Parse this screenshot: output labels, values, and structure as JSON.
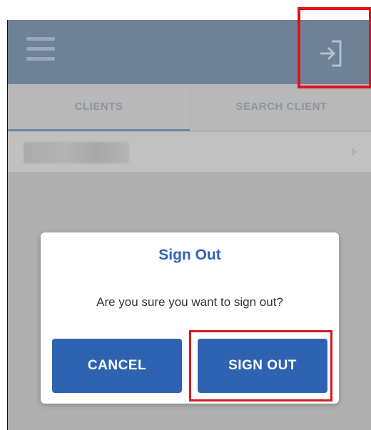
{
  "header": {
    "menu_icon": "hamburger-menu-icon",
    "signout_icon": "sign-out-icon"
  },
  "tabs": [
    {
      "label": "CLIENTS"
    },
    {
      "label": "SEARCH CLIENT"
    }
  ],
  "list": {
    "chevron": "›"
  },
  "dialog": {
    "title": "Sign Out",
    "message": "Are you sure you want to sign out?",
    "cancel_label": "CANCEL",
    "confirm_label": "SIGN OUT"
  },
  "colors": {
    "header_bg": "#6e8197",
    "dialog_title": "#2f63b4",
    "button_bg": "#2e63b1",
    "highlight": "#e0101b"
  }
}
